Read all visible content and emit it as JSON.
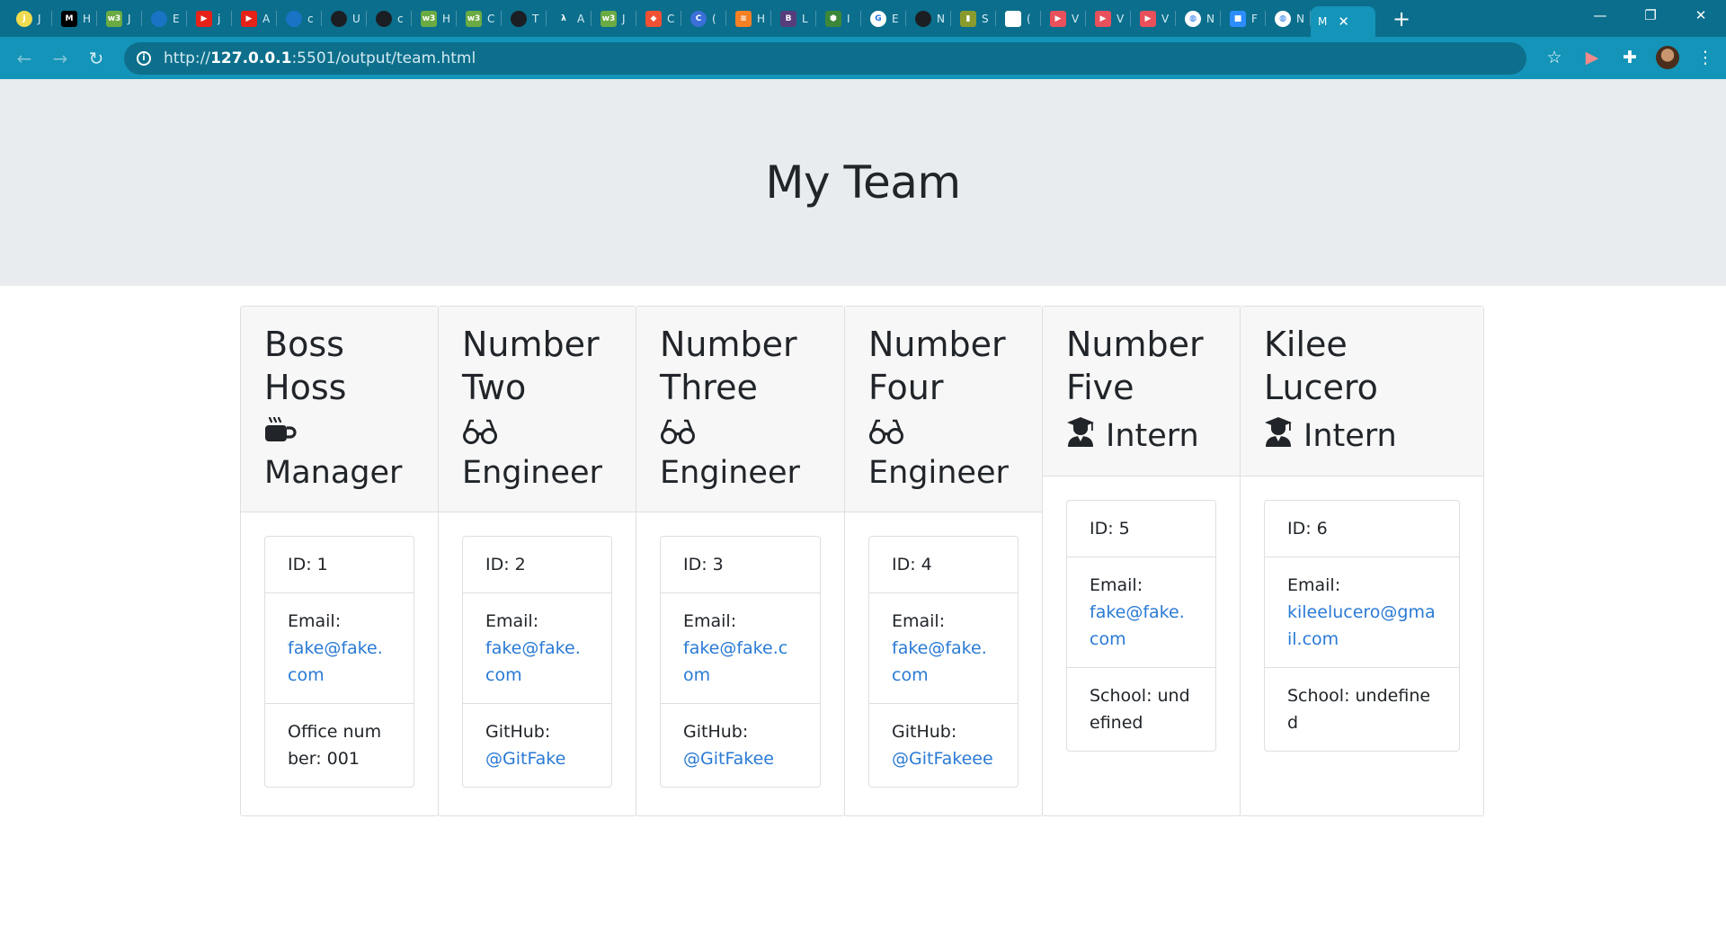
{
  "browser": {
    "tabs": [
      {
        "icon": "js-icon",
        "color": "#f0db4f",
        "text": "J",
        "letter": "J"
      },
      {
        "icon": "medium-icon",
        "color": "#000000",
        "text": "M",
        "letter": "H"
      },
      {
        "icon": "w3schools-icon",
        "color": "#6aab43",
        "text": "w3",
        "letter": "J"
      },
      {
        "icon": "edge-icon",
        "color": "#1a73c4",
        "text": "",
        "letter": "E"
      },
      {
        "icon": "youtube-icon",
        "color": "#e62117",
        "text": "▶",
        "letter": "j"
      },
      {
        "icon": "youtube-icon",
        "color": "#e62117",
        "text": "▶",
        "letter": "A"
      },
      {
        "icon": "edge-icon",
        "color": "#1a73c4",
        "text": "",
        "letter": "c"
      },
      {
        "icon": "github-icon",
        "color": "#1b1f23",
        "text": "",
        "letter": "U"
      },
      {
        "icon": "github-icon",
        "color": "#1b1f23",
        "text": "",
        "letter": "c"
      },
      {
        "icon": "w3schools-icon",
        "color": "#6aab43",
        "text": "w3",
        "letter": "H"
      },
      {
        "icon": "w3schools-icon",
        "color": "#6aab43",
        "text": "w3",
        "letter": "C"
      },
      {
        "icon": "github-icon",
        "color": "#1b1f23",
        "text": "",
        "letter": "T"
      },
      {
        "icon": "lambda-icon",
        "color": "#0b6e8c",
        "text": "λ",
        "letter": "A"
      },
      {
        "icon": "w3schools-icon",
        "color": "#6aab43",
        "text": "w3",
        "letter": "J"
      },
      {
        "icon": "git-icon",
        "color": "#f05033",
        "text": "◆",
        "letter": "C"
      },
      {
        "icon": "c-icon",
        "color": "#3a6fd8",
        "text": "C",
        "letter": "("
      },
      {
        "icon": "stackoverflow-icon",
        "color": "#f48024",
        "text": "≡",
        "letter": "H"
      },
      {
        "icon": "bootstrap-icon",
        "color": "#563d7c",
        "text": "B",
        "letter": "L"
      },
      {
        "icon": "node-icon",
        "color": "#3c873a",
        "text": "⬢",
        "letter": "I"
      },
      {
        "icon": "google-icon",
        "color": "#ffffff",
        "text": "G",
        "letter": "E"
      },
      {
        "icon": "github-icon",
        "color": "#1b1f23",
        "text": "",
        "letter": "N"
      },
      {
        "icon": "book-icon",
        "color": "#8a9b2d",
        "text": "▮",
        "letter": "S"
      },
      {
        "icon": "page-icon",
        "color": "#ffffff",
        "text": "",
        "letter": "("
      },
      {
        "icon": "video-icon",
        "color": "#e8505b",
        "text": "▶",
        "letter": "V"
      },
      {
        "icon": "video-icon",
        "color": "#e8505b",
        "text": "▶",
        "letter": "V"
      },
      {
        "icon": "video-icon",
        "color": "#e8505b",
        "text": "▶",
        "letter": "V"
      },
      {
        "icon": "globe-icon",
        "color": "#ffffff",
        "text": "◍",
        "letter": "N"
      },
      {
        "icon": "zoom-icon",
        "color": "#2d8cff",
        "text": "■",
        "letter": "F"
      },
      {
        "icon": "globe-icon",
        "color": "#ffffff",
        "text": "◍",
        "letter": "N"
      }
    ],
    "active_tab": "M",
    "url_scheme": "http://",
    "url_host": "127.0.0.1",
    "url_rest": ":5501/output/team.html"
  },
  "page": {
    "title": "My Team"
  },
  "team": [
    {
      "name": "Boss Hoss",
      "role": "Manager",
      "role_icon": "coffee-icon",
      "id": "ID: 1",
      "email_label": "Email:",
      "email": "fake@fake.com",
      "extra_label": "Office number: 001",
      "extra_link": ""
    },
    {
      "name": "Number Two",
      "role": "Engineer",
      "role_icon": "glasses-icon",
      "id": "ID: 2",
      "email_label": "Email:",
      "email": "fake@fake.com",
      "extra_label": "GitHub:",
      "extra_link": "@GitFake"
    },
    {
      "name": "Number Three",
      "role": "Engineer",
      "role_icon": "glasses-icon",
      "id": "ID: 3",
      "email_label": "Email:",
      "email": "fake@fake.com",
      "extra_label": "GitHub:",
      "extra_link": "@GitFakee"
    },
    {
      "name": "Number Four",
      "role": "Engineer",
      "role_icon": "glasses-icon",
      "id": "ID: 4",
      "email_label": "Email:",
      "email": "fake@fake.com",
      "extra_label": "GitHub:",
      "extra_link": "@GitFakeee"
    },
    {
      "name": "Number Five",
      "role": "Intern",
      "role_icon": "graduate-icon",
      "id": "ID: 5",
      "email_label": "Email:",
      "email": "fake@fake.com",
      "extra_label": "School: undefined",
      "extra_link": ""
    },
    {
      "name": "Kilee Lucero",
      "role": "Intern",
      "role_icon": "graduate-icon",
      "id": "ID: 6",
      "email_label": "Email:",
      "email": "kileelucero@gmail.com",
      "extra_label": "School: undefined",
      "extra_link": ""
    }
  ]
}
